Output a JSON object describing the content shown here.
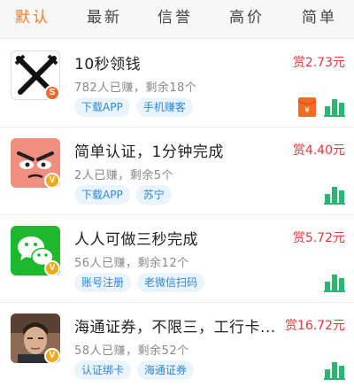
{
  "tabs": [
    {
      "label": "默认",
      "active": true
    },
    {
      "label": "最新",
      "active": false
    },
    {
      "label": "信誉",
      "active": false
    },
    {
      "label": "高价",
      "active": false
    },
    {
      "label": "简单",
      "active": false
    }
  ],
  "colors": {
    "accent": "#f07c2a",
    "reward": "#e4393c",
    "tag_text": "#2f88d6",
    "tag_bg": "#eaf4fc",
    "chart_icon": "#2bb673"
  },
  "tasks": [
    {
      "icon": "swords-icon",
      "badge": "S",
      "title": "10秒领钱",
      "stats": "782人已赚，剩余18个",
      "tags": [
        "下载APP",
        "手机赚客"
      ],
      "reward": "赏2.73元",
      "has_red_packet": true
    },
    {
      "icon": "angry-face-icon",
      "badge": "V",
      "title": "简单认证，1分钟完成",
      "stats": "2人已赚，剩余5个",
      "tags": [
        "下载APP",
        "苏宁"
      ],
      "reward": "赏4.40元",
      "has_red_packet": false
    },
    {
      "icon": "wechat-icon",
      "badge": "V",
      "title": "人人可做三秒完成",
      "stats": "56人已赚，剩余12个",
      "tags": [
        "账号注册",
        "老微信扫码"
      ],
      "reward": "赏5.72元",
      "has_red_packet": false
    },
    {
      "icon": "avatar-photo",
      "badge": "V",
      "title": "海通证券，不限三，工行卡...",
      "stats": "58人已赚，剩余52个",
      "tags": [
        "认证绑卡",
        "海通证券"
      ],
      "reward": "赏16.72元",
      "has_red_packet": false
    }
  ]
}
